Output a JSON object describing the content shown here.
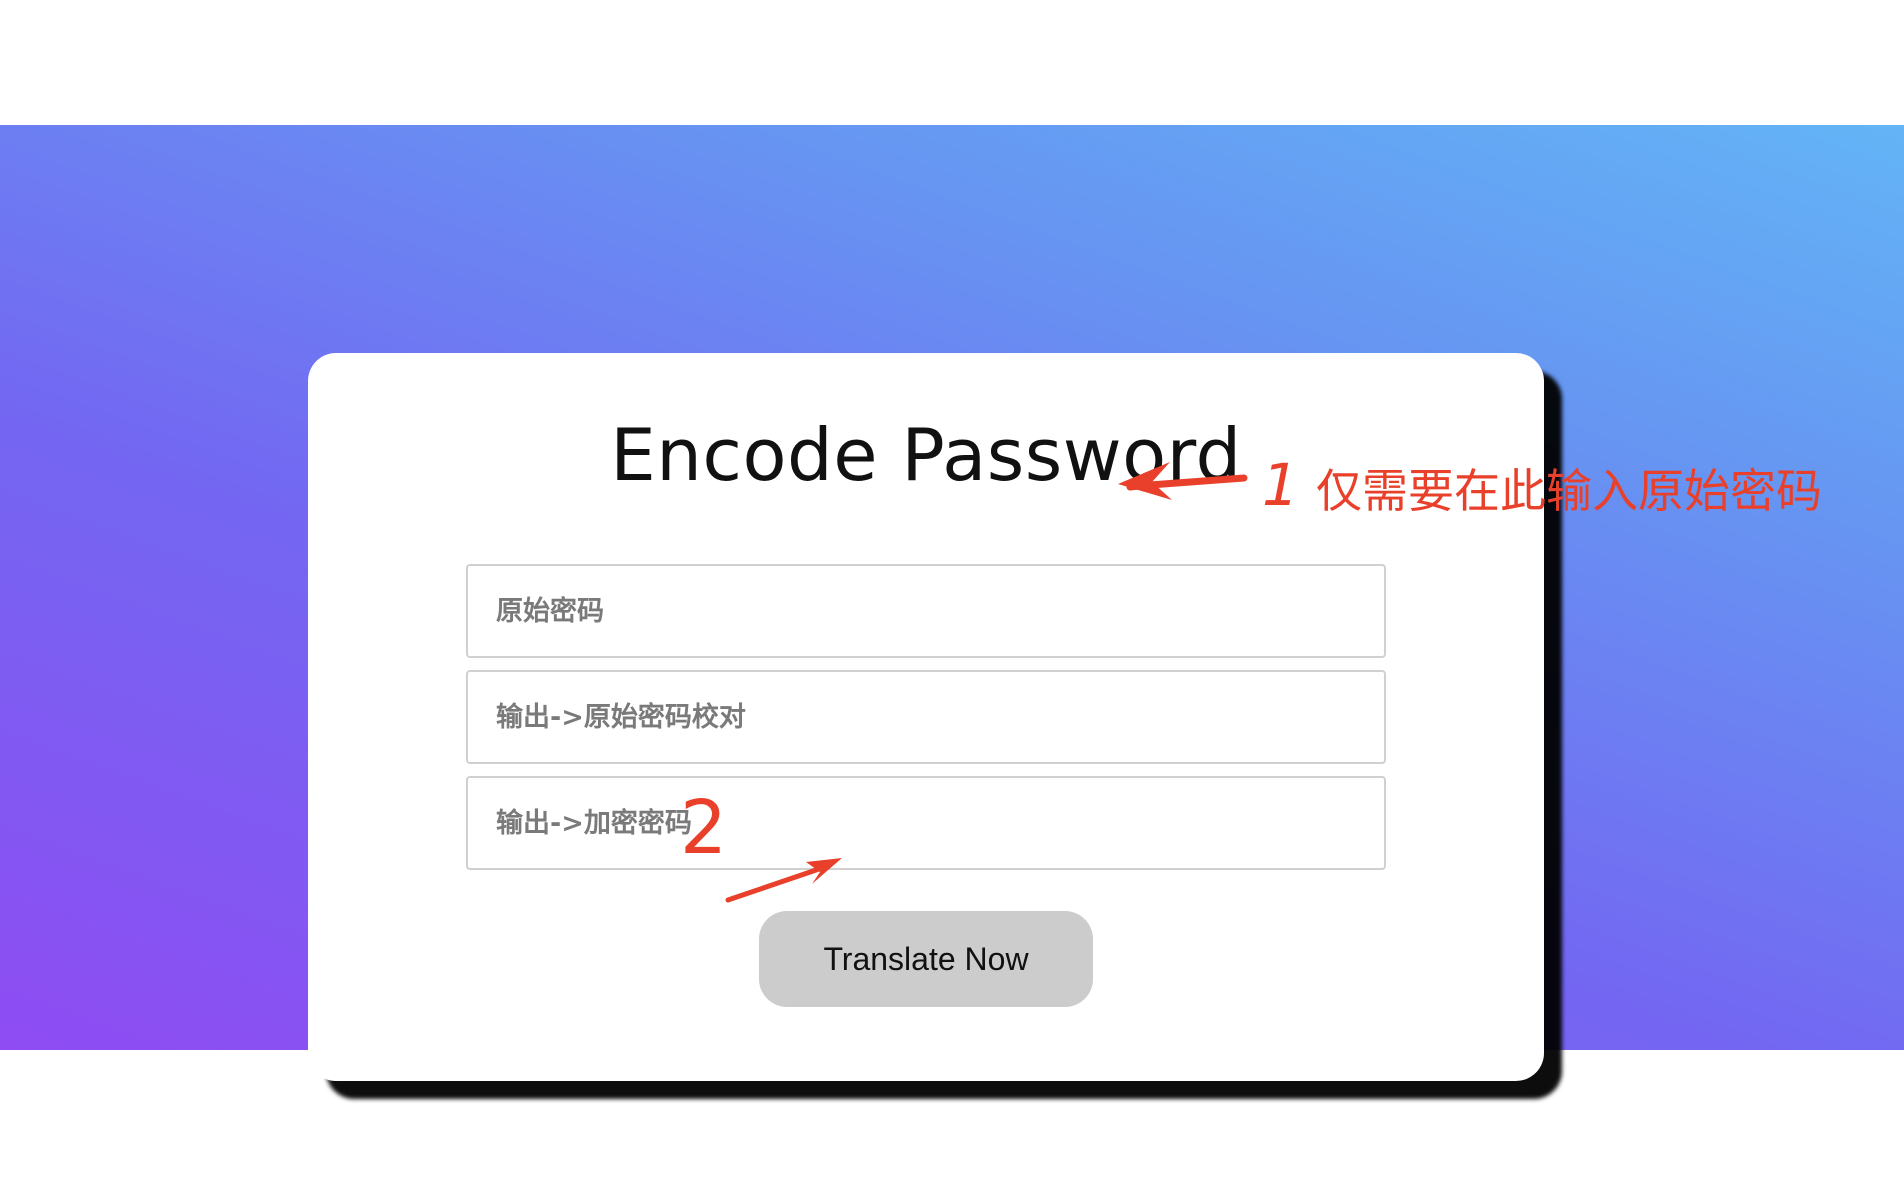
{
  "page": {
    "title": "Encode Password"
  },
  "form": {
    "original_password": {
      "placeholder": "原始密码",
      "value": ""
    },
    "output_check": {
      "placeholder": "输出->原始密码校对",
      "value": ""
    },
    "output_encrypted": {
      "placeholder": "输出->加密密码",
      "value": ""
    },
    "submit_label": "Translate Now"
  },
  "annotations": {
    "step1_number": "1",
    "step1_note": "仅需要在此输入原始密码",
    "step2_number": "2",
    "color": "#e8402a"
  },
  "colors": {
    "gradient_start": "#8e4cf2",
    "gradient_end": "#63b4f6",
    "button_bg": "#cccccc",
    "card_bg": "#ffffff"
  }
}
